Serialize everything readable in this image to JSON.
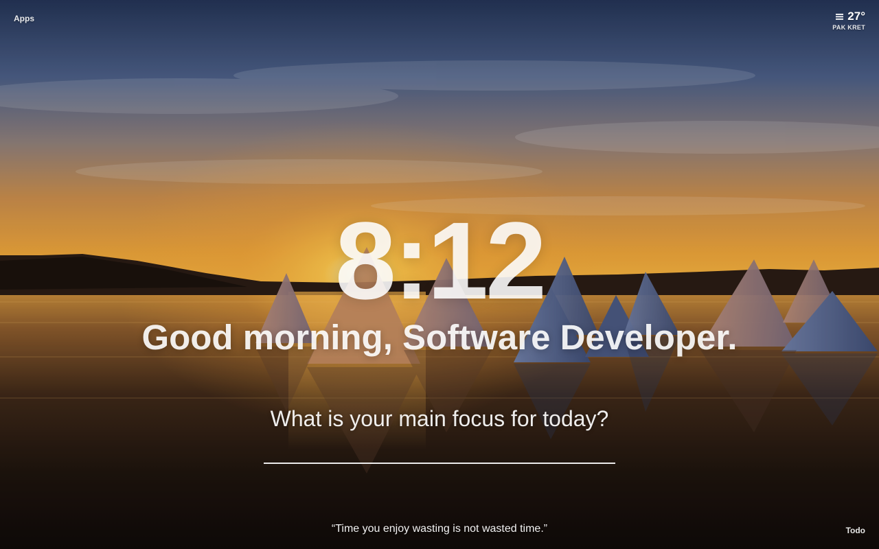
{
  "top_left": {
    "apps_label": "Apps"
  },
  "weather": {
    "icon": "cloud-bars-icon",
    "temperature": "27°",
    "location": "PAK KRET"
  },
  "clock": {
    "time": "8:12"
  },
  "greeting": {
    "text": "Good morning, Software Developer."
  },
  "focus": {
    "prompt": "What is your main focus for today?",
    "value": ""
  },
  "footer": {
    "quote": "“Time you enjoy wasting is not wasted time.”",
    "todo_label": "Todo"
  },
  "background": {
    "description_icon": "sunset-lake-background",
    "accent_colors": [
      "#f5a623",
      "#2b3a5e",
      "#120c08"
    ]
  }
}
